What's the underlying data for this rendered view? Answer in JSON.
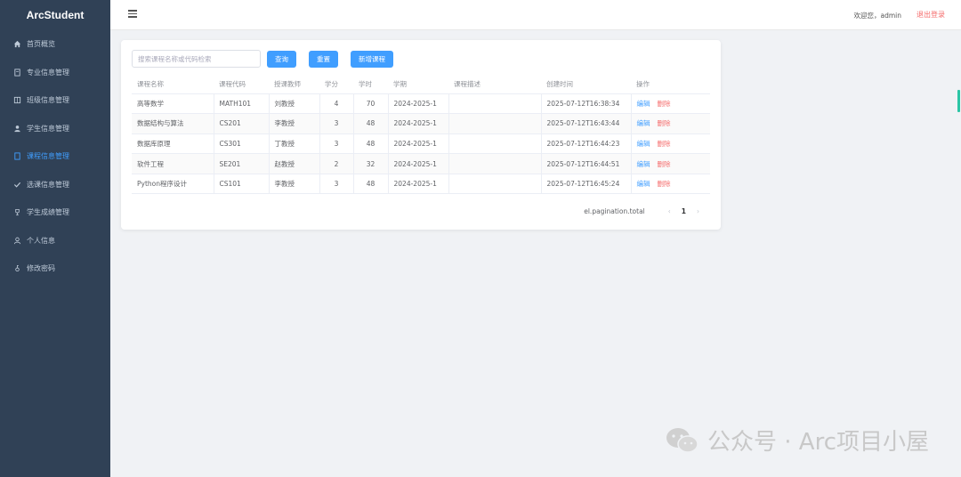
{
  "app": {
    "title": "ArcStudent"
  },
  "sidebar": {
    "items": [
      {
        "label": "首页概览",
        "icon": "home-icon",
        "active": false
      },
      {
        "label": "专业信息管理",
        "icon": "document-icon",
        "active": false
      },
      {
        "label": "班级信息管理",
        "icon": "book-icon",
        "active": false
      },
      {
        "label": "学生信息管理",
        "icon": "user-icon",
        "active": false
      },
      {
        "label": "课程信息管理",
        "icon": "notebook-icon",
        "active": true
      },
      {
        "label": "选课信息管理",
        "icon": "check-icon",
        "active": false
      },
      {
        "label": "学生成绩管理",
        "icon": "trophy-icon",
        "active": false
      },
      {
        "label": "个人信息",
        "icon": "person-icon",
        "active": false
      },
      {
        "label": "修改密码",
        "icon": "lock-icon",
        "active": false
      }
    ]
  },
  "header": {
    "welcome": "欢迎您，admin",
    "logout": "退出登录"
  },
  "toolbar": {
    "search_placeholder": "搜索课程名称或代码检索",
    "query_label": "查询",
    "reset_label": "重置",
    "add_label": "新增课程"
  },
  "table": {
    "columns": [
      "课程名称",
      "课程代码",
      "授课教师",
      "学分",
      "学时",
      "学期",
      "课程描述",
      "创建时间",
      "操作"
    ],
    "rows": [
      {
        "name": "高等数学",
        "code": "MATH101",
        "teacher": "刘教授",
        "credit": "4",
        "hours": "70",
        "term": "2024-2025-1",
        "desc": "",
        "created": "2025-07-12T16:38:34"
      },
      {
        "name": "数据结构与算法",
        "code": "CS201",
        "teacher": "李教授",
        "credit": "3",
        "hours": "48",
        "term": "2024-2025-1",
        "desc": "",
        "created": "2025-07-12T16:43:44"
      },
      {
        "name": "数据库原理",
        "code": "CS301",
        "teacher": "丁教授",
        "credit": "3",
        "hours": "48",
        "term": "2024-2025-1",
        "desc": "",
        "created": "2025-07-12T16:44:23"
      },
      {
        "name": "软件工程",
        "code": "SE201",
        "teacher": "赵教授",
        "credit": "2",
        "hours": "32",
        "term": "2024-2025-1",
        "desc": "",
        "created": "2025-07-12T16:44:51"
      },
      {
        "name": "Python程序设计",
        "code": "CS101",
        "teacher": "李教授",
        "credit": "3",
        "hours": "48",
        "term": "2024-2025-1",
        "desc": "",
        "created": "2025-07-12T16:45:24"
      }
    ],
    "edit_label": "编辑",
    "delete_label": "删除"
  },
  "pagination": {
    "total_text": "el.pagination.total",
    "current_page": "1",
    "prev": "‹",
    "next": "›"
  },
  "watermark": {
    "text": "公众号 · Arc项目小屋"
  }
}
